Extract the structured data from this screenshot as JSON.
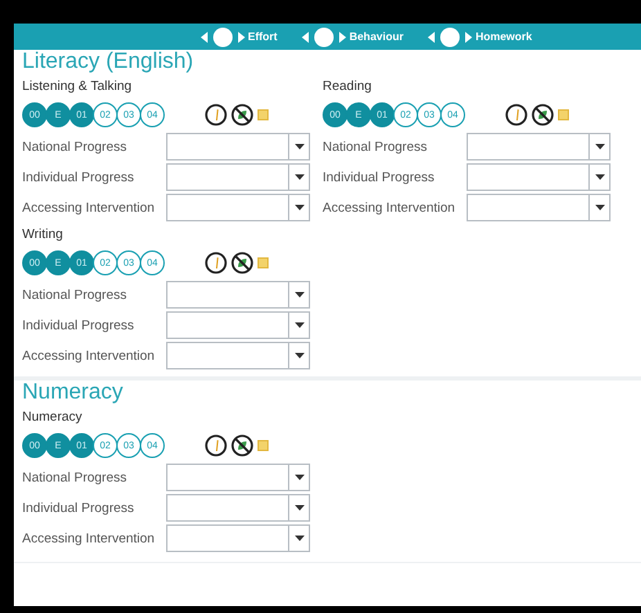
{
  "toggles": [
    {
      "label": "Effort"
    },
    {
      "label": "Behaviour"
    },
    {
      "label": "Homework"
    }
  ],
  "sections": [
    {
      "title": "Literacy (English)",
      "subjects": [
        {
          "name": "Listening & Talking",
          "levels": [
            {
              "label": "00",
              "selected": true
            },
            {
              "label": "E",
              "selected": true
            },
            {
              "label": "01",
              "selected": true
            },
            {
              "label": "02",
              "selected": false
            },
            {
              "label": "03",
              "selected": false
            },
            {
              "label": "04",
              "selected": false
            }
          ],
          "rows": [
            {
              "label": "National Progress"
            },
            {
              "label": "Individual Progress"
            },
            {
              "label": "Accessing Intervention"
            }
          ]
        },
        {
          "name": "Reading",
          "levels": [
            {
              "label": "00",
              "selected": true
            },
            {
              "label": "E",
              "selected": true
            },
            {
              "label": "01",
              "selected": true
            },
            {
              "label": "02",
              "selected": false
            },
            {
              "label": "03",
              "selected": false
            },
            {
              "label": "04",
              "selected": false
            }
          ],
          "rows": [
            {
              "label": "National Progress"
            },
            {
              "label": "Individual Progress"
            },
            {
              "label": "Accessing Intervention"
            }
          ]
        },
        {
          "name": "Writing",
          "levels": [
            {
              "label": "00",
              "selected": true
            },
            {
              "label": "E",
              "selected": true
            },
            {
              "label": "01",
              "selected": true
            },
            {
              "label": "02",
              "selected": false
            },
            {
              "label": "03",
              "selected": false
            },
            {
              "label": "04",
              "selected": false
            }
          ],
          "rows": [
            {
              "label": "National Progress"
            },
            {
              "label": "Individual Progress"
            },
            {
              "label": "Accessing Intervention"
            }
          ]
        }
      ]
    },
    {
      "title": "Numeracy",
      "subjects": [
        {
          "name": "Numeracy",
          "levels": [
            {
              "label": "00",
              "selected": true
            },
            {
              "label": "E",
              "selected": true
            },
            {
              "label": "01",
              "selected": true
            },
            {
              "label": "02",
              "selected": false
            },
            {
              "label": "03",
              "selected": false
            },
            {
              "label": "04",
              "selected": false
            }
          ],
          "rows": [
            {
              "label": "National Progress"
            },
            {
              "label": "Individual Progress"
            },
            {
              "label": "Accessing Intervention"
            }
          ]
        }
      ]
    }
  ]
}
